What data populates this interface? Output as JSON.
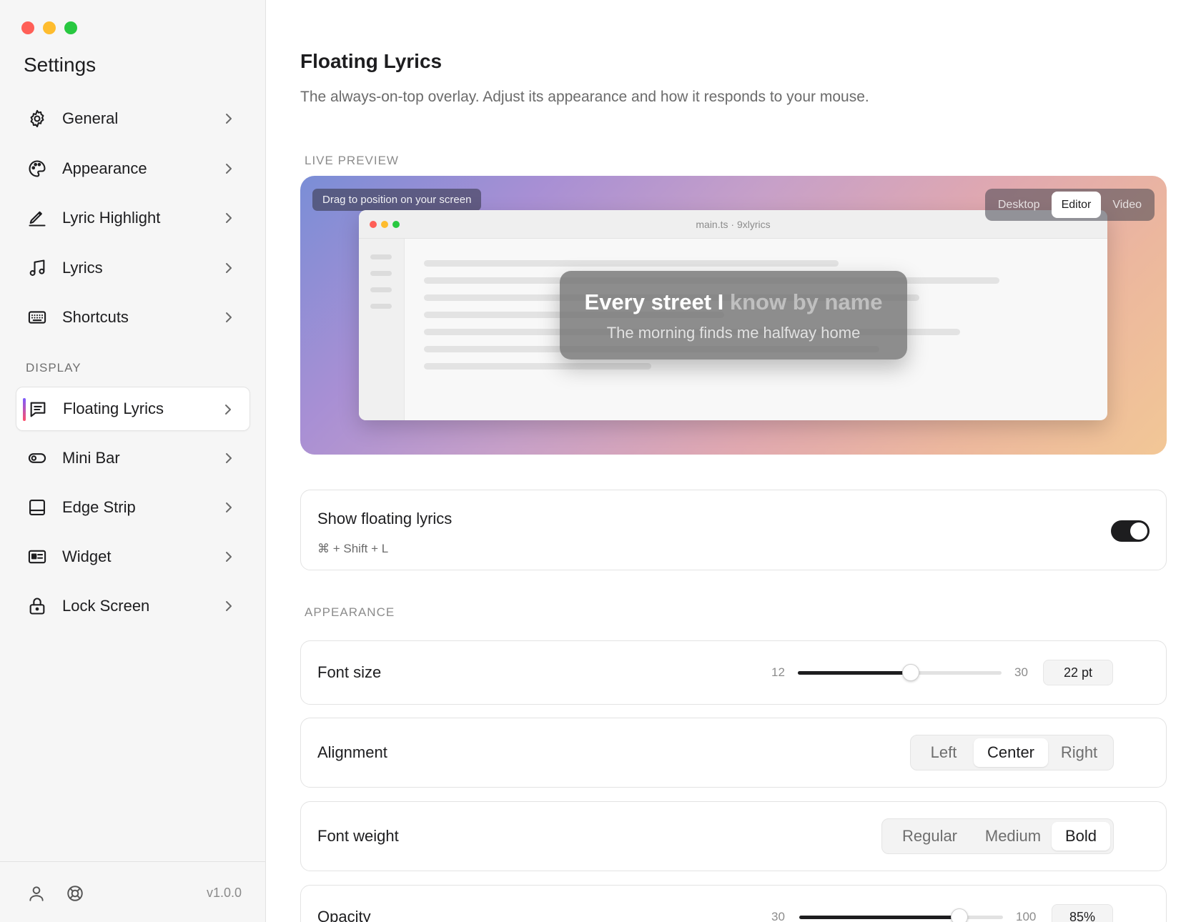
{
  "window": {
    "controls": {
      "close_color": "#ff5f57",
      "minimize_color": "#febc2e",
      "zoom_color": "#28c840"
    }
  },
  "sidebar": {
    "title": "Settings",
    "items": [
      {
        "label": "General",
        "icon": "gear-icon"
      },
      {
        "label": "Appearance",
        "icon": "palette-icon"
      },
      {
        "label": "Lyric Highlight",
        "icon": "pen-icon"
      },
      {
        "label": "Lyrics",
        "icon": "music-note-icon"
      },
      {
        "label": "Shortcuts",
        "icon": "keyboard-icon"
      }
    ],
    "display_section": "DISPLAY",
    "display_items": [
      {
        "label": "Floating Lyrics",
        "icon": "message-icon",
        "active": true
      },
      {
        "label": "Mini Bar",
        "icon": "pill-icon"
      },
      {
        "label": "Edge Strip",
        "icon": "edge-strip-icon"
      },
      {
        "label": "Widget",
        "icon": "widget-card-icon"
      },
      {
        "label": "Lock Screen",
        "icon": "lock-icon"
      }
    ],
    "footer": {
      "version": "v1.0.0",
      "icons": [
        "user-icon",
        "help-lifebuoy-icon"
      ]
    }
  },
  "main": {
    "title": "Floating Lyrics",
    "subtitle": "The always-on-top overlay. Adjust its appearance and how it responds to your mouse.",
    "live_preview": {
      "section": "LIVE PREVIEW",
      "drag_hint": "Drag to position on your screen",
      "modes": [
        "Desktop",
        "Editor",
        "Video"
      ],
      "selected_mode": "Editor",
      "window_title": "main.ts · 9xlyrics",
      "lyric_sung": "Every street I",
      "lyric_unsung": " know by name",
      "lyric_next": "The morning finds me halfway home"
    },
    "show_floating": {
      "label": "Show floating lyrics",
      "shortcut": "⌘ + Shift + L",
      "enabled": true
    },
    "appearance": {
      "section": "APPEARANCE",
      "font_size": {
        "label": "Font size",
        "min": "12",
        "max": "30",
        "value": "22 pt",
        "level": 0.555
      },
      "alignment": {
        "label": "Alignment",
        "options": [
          "Left",
          "Center",
          "Right"
        ],
        "selected": "Center"
      },
      "font_weight": {
        "label": "Font weight",
        "options": [
          "Regular",
          "Medium",
          "Bold"
        ],
        "selected": "Bold"
      },
      "opacity": {
        "label": "Opacity",
        "min": "30",
        "max": "100",
        "value": "85%",
        "level": 0.786
      }
    }
  },
  "colors": {
    "accent_dark": "#1d1d1f",
    "active_bar_top": "#7b5cff",
    "active_bar_bottom": "#ff4f6a"
  }
}
